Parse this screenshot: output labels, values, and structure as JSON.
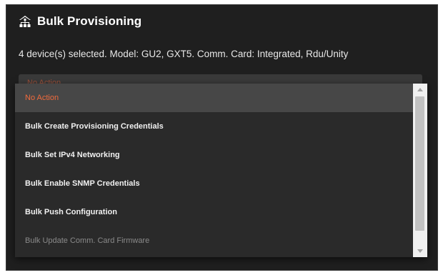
{
  "header": {
    "title": "Bulk Provisioning",
    "icon": "network-devices-icon"
  },
  "subtitle": "4 device(s) selected. Model: GU2, GXT5. Comm. Card: Integrated, Rdu/Unity",
  "select": {
    "current_value": "No Action"
  },
  "dropdown": {
    "options": [
      {
        "label": "No Action",
        "state": "selected"
      },
      {
        "label": "Bulk Create Provisioning Credentials",
        "state": "normal"
      },
      {
        "label": "Bulk Set IPv4 Networking",
        "state": "normal"
      },
      {
        "label": "Bulk Enable SNMP Credentials",
        "state": "normal"
      },
      {
        "label": "Bulk Push Configuration",
        "state": "normal"
      },
      {
        "label": "Bulk Update Comm. Card Firmware",
        "state": "disabled"
      }
    ]
  },
  "colors": {
    "panel_background": "#1f1f1f",
    "accent_orange": "#f06a3c",
    "dropdown_background": "#2a2a2a",
    "selected_background": "#474747"
  }
}
